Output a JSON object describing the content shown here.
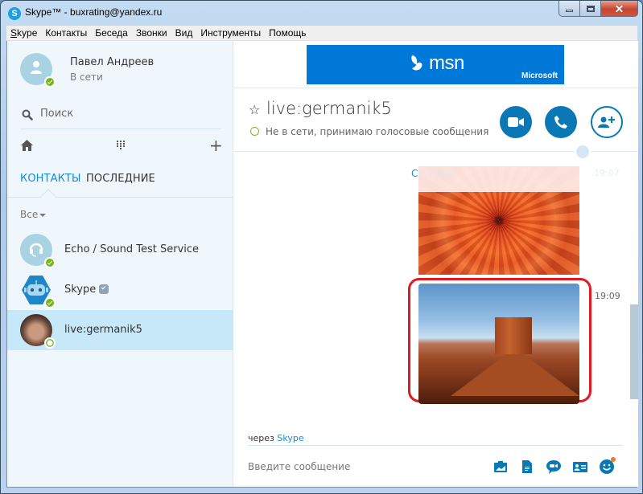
{
  "window": {
    "title": "Skype™ - buxrating@yandex.ru",
    "app_icon_letter": "S",
    "controls": {
      "minimize": "minimize",
      "maximize": "maximize",
      "close": "✕"
    }
  },
  "menu": {
    "items": [
      {
        "label": "Skype",
        "mnemonic": "S"
      },
      {
        "label": "Контакты"
      },
      {
        "label": "Беседа"
      },
      {
        "label": "Звонки"
      },
      {
        "label": "Вид"
      },
      {
        "label": "Инструменты"
      },
      {
        "label": "Помощь"
      }
    ]
  },
  "profile": {
    "name": "Павел Андреев",
    "status": "В сети",
    "status_color": "#74b517"
  },
  "sidebar": {
    "search_placeholder": "Поиск",
    "nav_icons": [
      "home-icon",
      "dialpad-icon",
      "plus-icon"
    ],
    "plus_glyph": "+",
    "tabs": [
      {
        "label": "КОНТАКТЫ",
        "active": true
      },
      {
        "label": "ПОСЛЕДНИЕ",
        "active": false
      }
    ],
    "filter_label": "Все",
    "contacts": [
      {
        "name": "Echo / Sound Test Service",
        "status": "online",
        "selected": false
      },
      {
        "name": "Skype",
        "status": "online",
        "verified": true,
        "selected": false
      },
      {
        "name": "live:germanik5",
        "status": "offline",
        "selected": true
      }
    ]
  },
  "ad": {
    "brand": "msn",
    "company": "Microsoft",
    "color": "#0078d7"
  },
  "chat": {
    "title": "live:germanik5",
    "star_glyph": "☆",
    "presence_text": "Не в сети, принимаю голосовые сообщения",
    "actions": [
      "video-call",
      "audio-call",
      "add-people"
    ],
    "accent_color": "#0a78b4",
    "date_label": "Сегодня",
    "messages": [
      {
        "type": "image",
        "subject": "orange chrysanthemum flower",
        "time": "19:07"
      },
      {
        "type": "image",
        "subject": "desert butte landscape",
        "time": "19:09",
        "highlighted": true
      }
    ],
    "via_prefix": "через",
    "via_link": "Skype",
    "compose_placeholder": "Введите сообщение",
    "compose_tools": [
      "send-photo",
      "send-file",
      "video-message",
      "send-contact",
      "emoticons"
    ]
  },
  "highlight_color": "#e11a22"
}
